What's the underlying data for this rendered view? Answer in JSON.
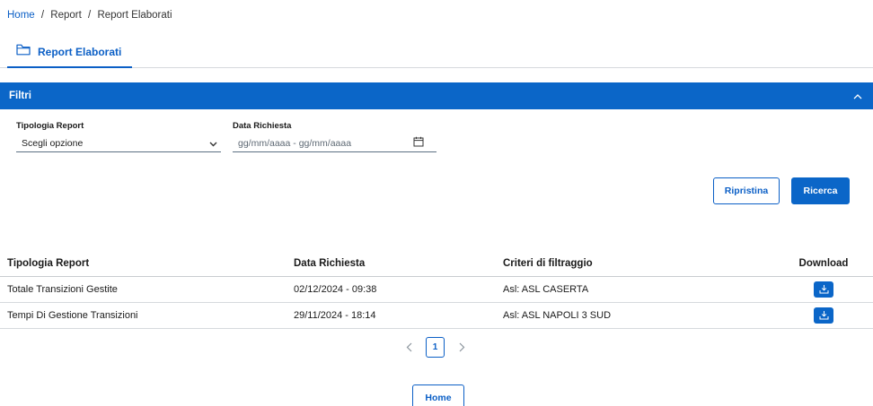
{
  "breadcrumb": {
    "home": "Home",
    "sep": "/",
    "report": "Report",
    "current": "Report Elaborati"
  },
  "tab": {
    "label": "Report Elaborati",
    "icon": "folder-icon"
  },
  "filters": {
    "title": "Filtri",
    "tipologia": {
      "label": "Tipologia Report",
      "value": "Scegli opzione"
    },
    "data": {
      "label": "Data Richiesta",
      "placeholder": "gg/mm/aaaa - gg/mm/aaaa"
    },
    "reset_label": "Ripristina",
    "search_label": "Ricerca"
  },
  "table": {
    "headers": [
      "Tipologia Report",
      "Data Richiesta",
      "Criteri di filtraggio",
      "Download"
    ],
    "rows": [
      [
        "Totale Transizioni Gestite",
        "02/12/2024 - 09:38",
        "Asl: ASL CASERTA"
      ],
      [
        "Tempi Di Gestione Transizioni",
        "29/11/2024 - 18:14",
        "Asl: ASL NAPOLI 3 SUD"
      ]
    ]
  },
  "pagination": {
    "current_page": "1"
  },
  "home_button": "Home",
  "colors": {
    "primary": "#0b66c8",
    "link": "#0b5fc6",
    "border": "#d6d9dd"
  }
}
